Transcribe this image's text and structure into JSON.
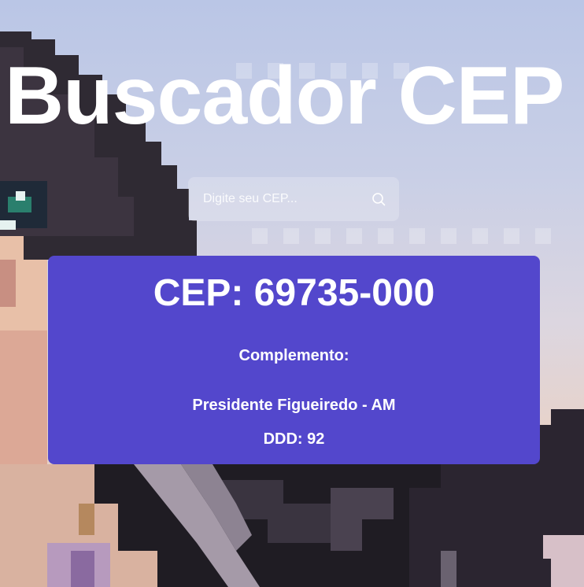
{
  "app": {
    "title": "Buscador CEP"
  },
  "search": {
    "placeholder": "Digite seu CEP...",
    "value": "",
    "button_icon": "search-icon"
  },
  "result": {
    "cep_label": "CEP: 69735-000",
    "complemento_label": "Complemento:",
    "city_state": "Presidente Figueiredo - AM",
    "ddd_label": "DDD: 92"
  },
  "colors": {
    "card_bg": "#5347cc",
    "text": "#ffffff",
    "sky": "#bac6e6"
  }
}
